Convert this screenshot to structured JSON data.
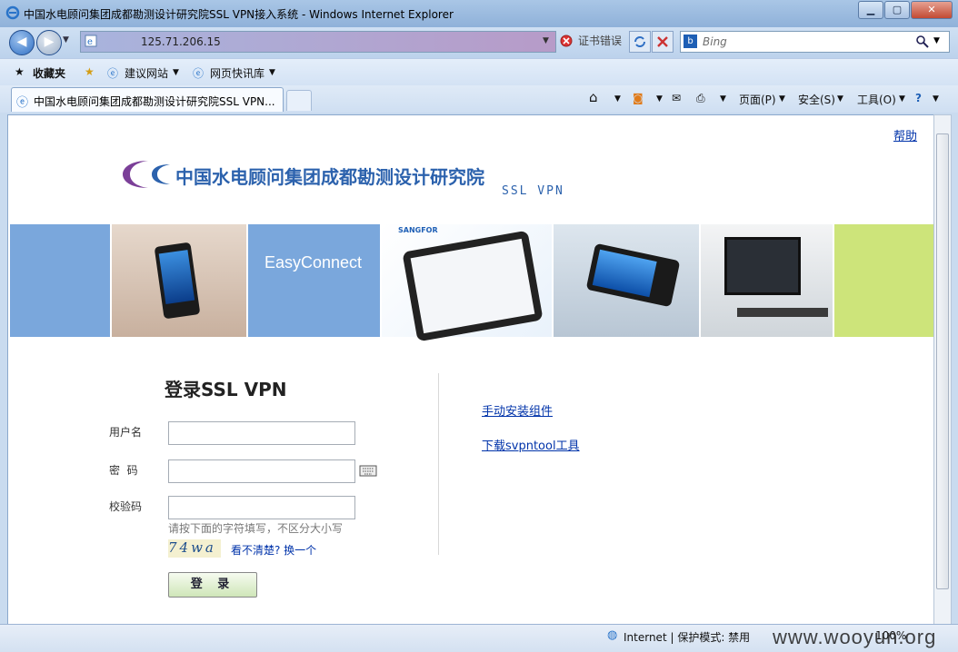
{
  "window": {
    "title": "中国水电顾问集团成都勘测设计研究院SSL VPN接入系统 - Windows Internet Explorer"
  },
  "address": {
    "url": "125.71.206.15",
    "cert_error": "证书错误"
  },
  "search": {
    "placeholder": "Bing"
  },
  "favorites": {
    "label": "收藏夹",
    "items": [
      "建议网站",
      "网页快讯库"
    ]
  },
  "tab": {
    "title": "中国水电顾问集团成都勘测设计研究院SSL VPN..."
  },
  "commands": {
    "page": "页面(P)",
    "safety": "安全(S)",
    "tools": "工具(O)"
  },
  "page": {
    "help_link": "帮助",
    "org_name": "中国水电顾问集团成都勘测设计研究院",
    "product": "SSL VPN",
    "banner_brand": "EasyConnect",
    "banner_logo": "SANGFOR"
  },
  "login": {
    "title": "登录SSL VPN",
    "username_label": "用户名",
    "password_label": "密  码",
    "captcha_label": "校验码",
    "captcha_hint": "请按下面的字符填写，不区分大小写",
    "captcha_text": "74wa",
    "refresh_link": "看不清楚? 换一个",
    "submit_label": "登 录"
  },
  "links": {
    "manual_install": "手动安装组件",
    "download_tool": "下载svpntool工具"
  },
  "status": {
    "zone": "Internet | 保护模式: 禁用",
    "zoom": "100%"
  },
  "watermark": "www.wooyun.org",
  "colors": {
    "brand_blue": "#2c62ad",
    "banner_blue": "#7aa7dc",
    "banner_green": "#cde47a"
  }
}
